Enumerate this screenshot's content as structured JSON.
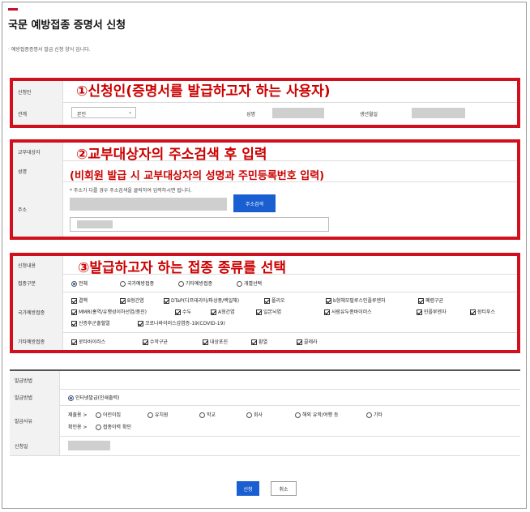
{
  "page": {
    "title": "국문 예방접종 증명서 신청",
    "intro": "· 예방접종증명서 발급 신청 양식 입니다."
  },
  "colors": {
    "annotation": "#cc0000",
    "border": "#d0101e",
    "primary_button": "#1a5fd1"
  },
  "applicant": {
    "section_label": "신청인",
    "annotation": "①신청인(증명서를 발급하고자 하는 사용자)",
    "relation_label": "관계",
    "relation_value": "본인",
    "name_label": "성명",
    "birth_label": "생년월일"
  },
  "recipient": {
    "section_label": "교부대상자",
    "annotation": "②교부대상자의 주소검색 후 입력",
    "annotation_sub": "(비회원 발급 시 교부대상자의 성명과 주민등록번호 입력)",
    "name_label": "성명",
    "address_label": "주소",
    "address_note": "* 주소가 다를 경우 주소검색을 클릭하여 입력하시면 됩니다.",
    "address_search_button": "주소검색"
  },
  "vaccine": {
    "section_label": "신청내용",
    "annotation": "③발급하고자 하는 접종 종류를 선택",
    "type_label": "접종구분",
    "type_options": [
      "전체",
      "국가예방접종",
      "기타예방접종",
      "개별선택"
    ],
    "national_label": "국가예방접종",
    "national_items": [
      "결핵",
      "B형간염",
      "DTaP(디프테리아/파상풍/백일해)",
      "폴리오",
      "b형헤모필루스인플루엔자",
      "폐렴구균",
      "MMR(홍역/유행성이하선염/풍진)",
      "수두",
      "A형간염",
      "일본뇌염",
      "사람유두종바이러스",
      "인플루엔자",
      "장티푸스",
      "신증후군출혈열",
      "코로나바이러스감염증-19(COVID-19)"
    ],
    "other_label": "기타예방접종",
    "other_items": [
      "로타바이러스",
      "수막구균",
      "대상포진",
      "황열",
      "콜레라"
    ]
  },
  "issuance": {
    "section_label": "발급방법",
    "method_label": "발급방법",
    "method_value": "인터넷발급(인쇄출력)",
    "reason_label": "발급사유",
    "reason_row1_prefix": "제출용 >",
    "reason_options": [
      "어린이집",
      "유치원",
      "학교",
      "회사",
      "해외 유학/여행 등",
      "기타"
    ],
    "reason_row2_prefix": "확인용 >",
    "reason_row2_option": "접종이력 확인",
    "applicant_label": "신청일"
  },
  "buttons": {
    "apply": "신청",
    "cancel": "취소"
  }
}
